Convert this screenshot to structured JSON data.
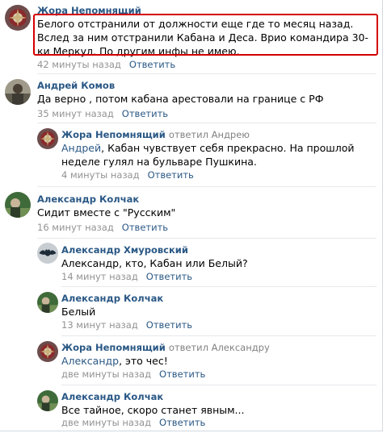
{
  "colors": {
    "link": "#2a5885",
    "meta": "#939393",
    "highlight": "#d40000"
  },
  "comments": [
    {
      "author": "Жора Непомнящий",
      "text": "Белого отстранили от должности еще где то месяц назад. Вслед за ним отстранили Кабана и Деса. Врио командира 30-ки Меркул. По другим инфы не имею.",
      "time": "42 минуты назад",
      "reply": "Ответить",
      "avatar_icon": "emblem-icon"
    },
    {
      "author": "Андрей Комов",
      "text": "Да верно , потом кабана арестовали на границе с РФ",
      "time": "35 минут назад",
      "reply": "Ответить",
      "avatar_icon": "photo-avatar"
    },
    {
      "author": "Жора Непомнящий",
      "replied_to": "ответил Андрею",
      "mention": "Андрей",
      "text": ", Кабан чувствует себя прекрасно. На прошлой неделе гулял на бульваре Пушкина.",
      "time": "4 минуты назад",
      "reply": "Ответить",
      "avatar_icon": "emblem-icon"
    },
    {
      "author": "Александр Колчак",
      "text": "Сидит вместе с \"Русским\"",
      "time": "16 минут назад",
      "reply": "Ответить",
      "avatar_icon": "photo-avatar"
    },
    {
      "author": "Александр Хмуровский",
      "text": "Александр, кто, Кабан или Белый?",
      "time": "14 минут назад",
      "reply": "Ответить",
      "avatar_icon": "bat-emblem-icon"
    },
    {
      "author": "Александр Колчак",
      "text": "Белый",
      "time": "13 минут назад",
      "reply": "Ответить",
      "avatar_icon": "photo-avatar"
    },
    {
      "author": "Жора Непомнящий",
      "replied_to": "ответил Александру",
      "mention": "Александр",
      "text": ", это чес!",
      "time": "две минуты назад",
      "reply": "Ответить",
      "avatar_icon": "emblem-icon"
    },
    {
      "author": "Александр Колчак",
      "text": "Все тайное, скоро станет явным...",
      "time": "две минуты назад",
      "reply": "Ответить",
      "avatar_icon": "photo-avatar"
    }
  ]
}
